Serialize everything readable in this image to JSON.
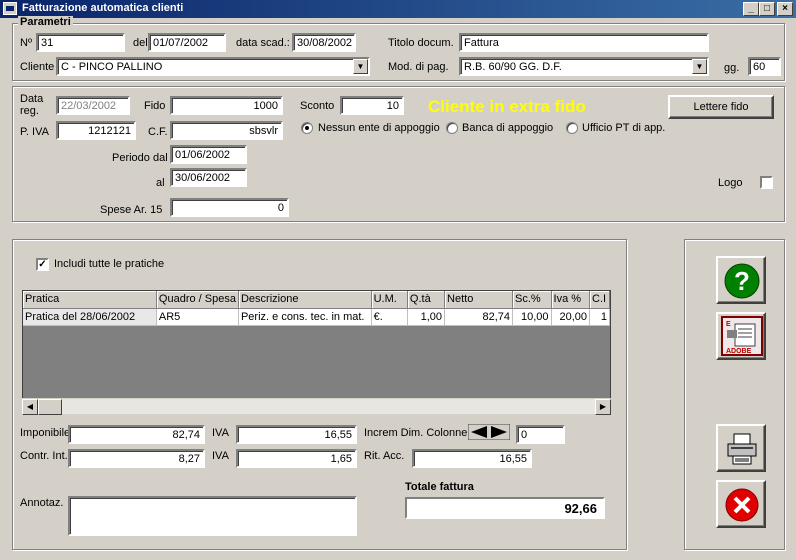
{
  "window": {
    "title": "Fatturazione automatica clienti"
  },
  "parametri": {
    "legend": "Parametri",
    "numero_label": "Nº",
    "numero": "31",
    "del_label": "del",
    "del": "01/07/2002",
    "data_scad_label": "data scad.:",
    "data_scad": "30/08/2002",
    "titolo_label": "Titolo docum.",
    "titolo": "Fattura",
    "cliente_label": "Cliente",
    "cliente": "C - PINCO PALLINO",
    "mod_pag_label": "Mod. di pag.",
    "mod_pag": "R.B. 60/90 GG. D.F.",
    "gg_label": "gg.",
    "gg": "60"
  },
  "dettagli": {
    "data_reg_label": "Data reg.",
    "data_reg": "22/03/2002",
    "fido_label": "Fido",
    "fido": "1000",
    "sconto_label": "Sconto",
    "sconto": "10",
    "extra_fido": "Cliente in extra fido",
    "lettere_fido": "Lettere fido",
    "piva_label": "P. IVA",
    "piva": "1212121",
    "cf_label": "C.F.",
    "cf": "sbsvlr",
    "radio_nessuno": "Nessun ente di appoggio",
    "radio_banca": "Banca di appoggio",
    "radio_ufficio": "Ufficio PT di app.",
    "periodo_dal_label": "Periodo dal",
    "periodo_dal": "01/06/2002",
    "al_label": "al",
    "al": "30/06/2002",
    "spese_label": "Spese Ar. 15",
    "spese": "0",
    "logo_label": "Logo"
  },
  "pratiche": {
    "includi_label": "Includi tutte le pratiche",
    "includi_checked": true,
    "columns": [
      "Pratica",
      "Quadro / Spesa",
      "Descrizione",
      "U.M.",
      "Q.tà",
      "Netto",
      "Sc.%",
      "Iva %",
      "C.I"
    ],
    "rows": [
      [
        "Pratica del 28/06/2002",
        "AR5",
        "Periz. e cons. tec. in mat.",
        "€.",
        "1,00",
        "82,74",
        "10,00",
        "20,00",
        "1"
      ]
    ]
  },
  "totali": {
    "imponibile_label": "Imponibile",
    "imponibile": "82,74",
    "iva_label": "IVA",
    "iva1": "16,55",
    "increm_label": "Increm Dim. Colonne",
    "increm": "0",
    "contr_label": "Contr. Int.",
    "contr": "8,27",
    "iva2": "1,65",
    "rit_label": "Rit. Acc.",
    "rit": "16,55",
    "annotaz_label": "Annotaz.",
    "totale_label": "Totale fattura",
    "totale": "92,66"
  },
  "icons": {
    "help": "help-icon",
    "adobe": "adobe-reader-icon",
    "print": "printer-icon",
    "close": "close-icon"
  },
  "colors": {
    "extra_fido": "#ffff00",
    "titlebar": "#0a246a",
    "help_green": "#008000",
    "close_red": "#e00000"
  }
}
